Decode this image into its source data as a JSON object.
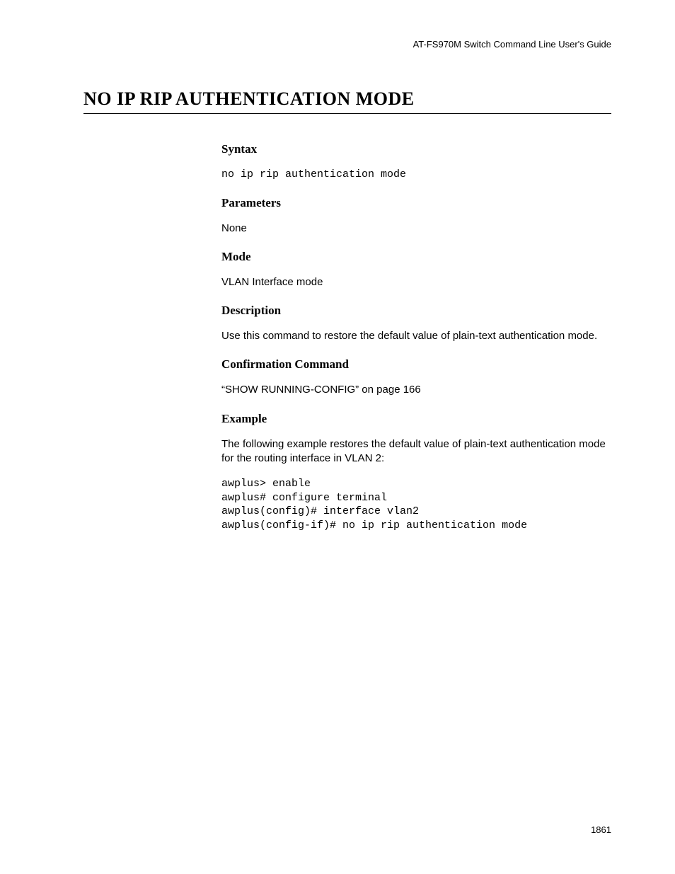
{
  "header": {
    "guide_title": "AT-FS970M Switch Command Line User's Guide"
  },
  "title": "NO IP RIP AUTHENTICATION MODE",
  "sections": {
    "syntax": {
      "heading": "Syntax",
      "command": "no ip rip authentication mode"
    },
    "parameters": {
      "heading": "Parameters",
      "value": "None"
    },
    "mode": {
      "heading": "Mode",
      "value": "VLAN Interface mode"
    },
    "description": {
      "heading": "Description",
      "text": "Use this command to restore the default value of plain-text authentication mode."
    },
    "confirmation": {
      "heading": "Confirmation Command",
      "text": "“SHOW RUNNING-CONFIG” on page 166"
    },
    "example": {
      "heading": "Example",
      "intro": "The following example restores the default value of plain-text authentication mode for the routing interface in VLAN 2:",
      "code": "awplus> enable\nawplus# configure terminal\nawplus(config)# interface vlan2\nawplus(config-if)# no ip rip authentication mode"
    }
  },
  "footer": {
    "page_number": "1861"
  }
}
